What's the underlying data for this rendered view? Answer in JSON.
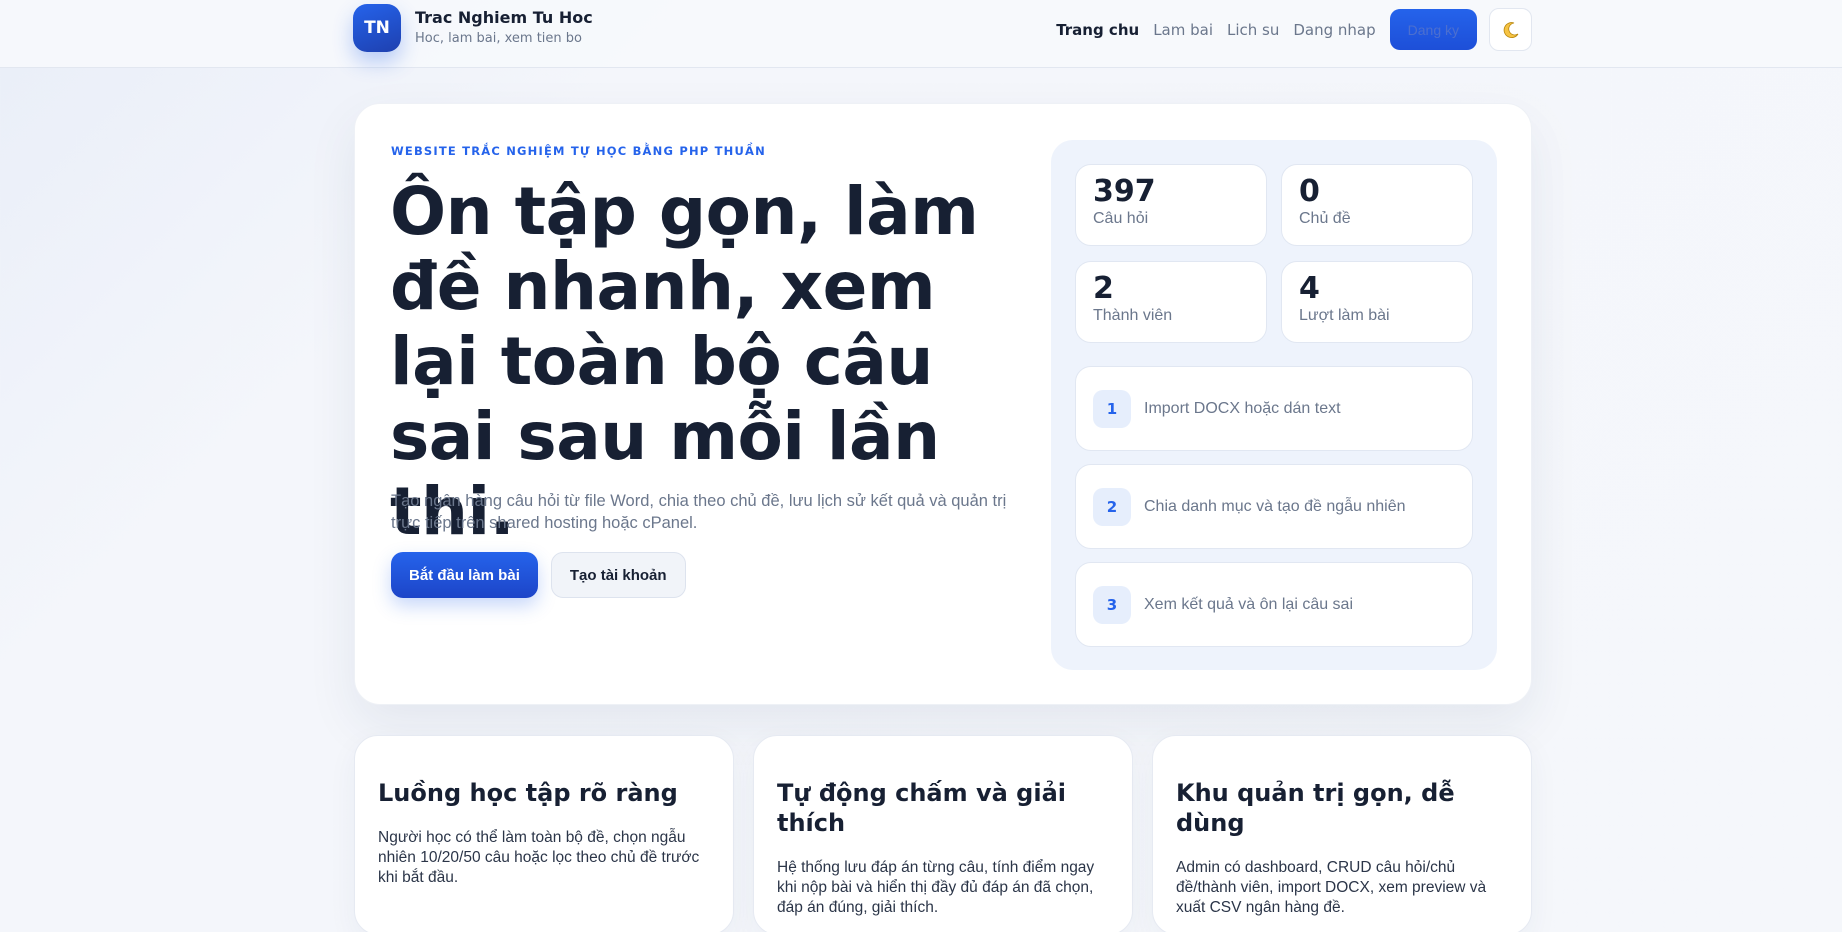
{
  "header": {
    "logo_text": "TN",
    "brand_title": "Trac Nghiem Tu Hoc",
    "brand_subtitle": "Hoc, lam bai, xem tien bo",
    "nav": [
      {
        "label": "Trang chu",
        "active": true
      },
      {
        "label": "Lam bai",
        "active": false
      },
      {
        "label": "Lich su",
        "active": false
      },
      {
        "label": "Dang nhap",
        "active": false
      }
    ],
    "register_label": "Dang ky",
    "theme_icon": "moon-icon"
  },
  "hero": {
    "eyebrow": "WEBSITE TRẮC NGHIỆM TỰ HỌC BẰNG PHP THUẦN",
    "title": "Ôn tập gọn, làm đề nhanh, xem lại toàn bộ câu sai sau mỗi lần thi.",
    "description": "Tạo ngân hàng câu hỏi từ file Word, chia theo chủ đề, lưu lịch sử kết quả và quản trị trực tiếp trên shared hosting hoặc cPanel.",
    "primary_cta": "Bắt đầu làm bài",
    "secondary_cta": "Tạo tài khoản"
  },
  "stats": [
    {
      "value": "397",
      "label": "Câu hỏi"
    },
    {
      "value": "0",
      "label": "Chủ đề"
    },
    {
      "value": "2",
      "label": "Thành viên"
    },
    {
      "value": "4",
      "label": "Lượt làm bài"
    }
  ],
  "steps": [
    {
      "num": "1",
      "text": "Import DOCX hoặc dán text"
    },
    {
      "num": "2",
      "text": "Chia danh mục và tạo đề ngẫu nhiên"
    },
    {
      "num": "3",
      "text": "Xem kết quả và ôn lại câu sai"
    }
  ],
  "features": [
    {
      "title": "Luồng học tập rõ ràng",
      "desc": "Người học có thể làm toàn bộ đề, chọn ngẫu nhiên 10/20/50 câu hoặc lọc theo chủ đề trước khi bắt đầu."
    },
    {
      "title": "Tự động chấm và giải thích",
      "desc": "Hệ thống lưu đáp án từng câu, tính điểm ngay khi nộp bài và hiển thị đầy đủ đáp án đã chọn, đáp án đúng, giải thích."
    },
    {
      "title": "Khu quản trị gọn, dễ dùng",
      "desc": "Admin có dashboard, CRUD câu hỏi/chủ đề/thành viên, import DOCX, xem preview và xuất CSV ngân hàng đề."
    }
  ]
}
